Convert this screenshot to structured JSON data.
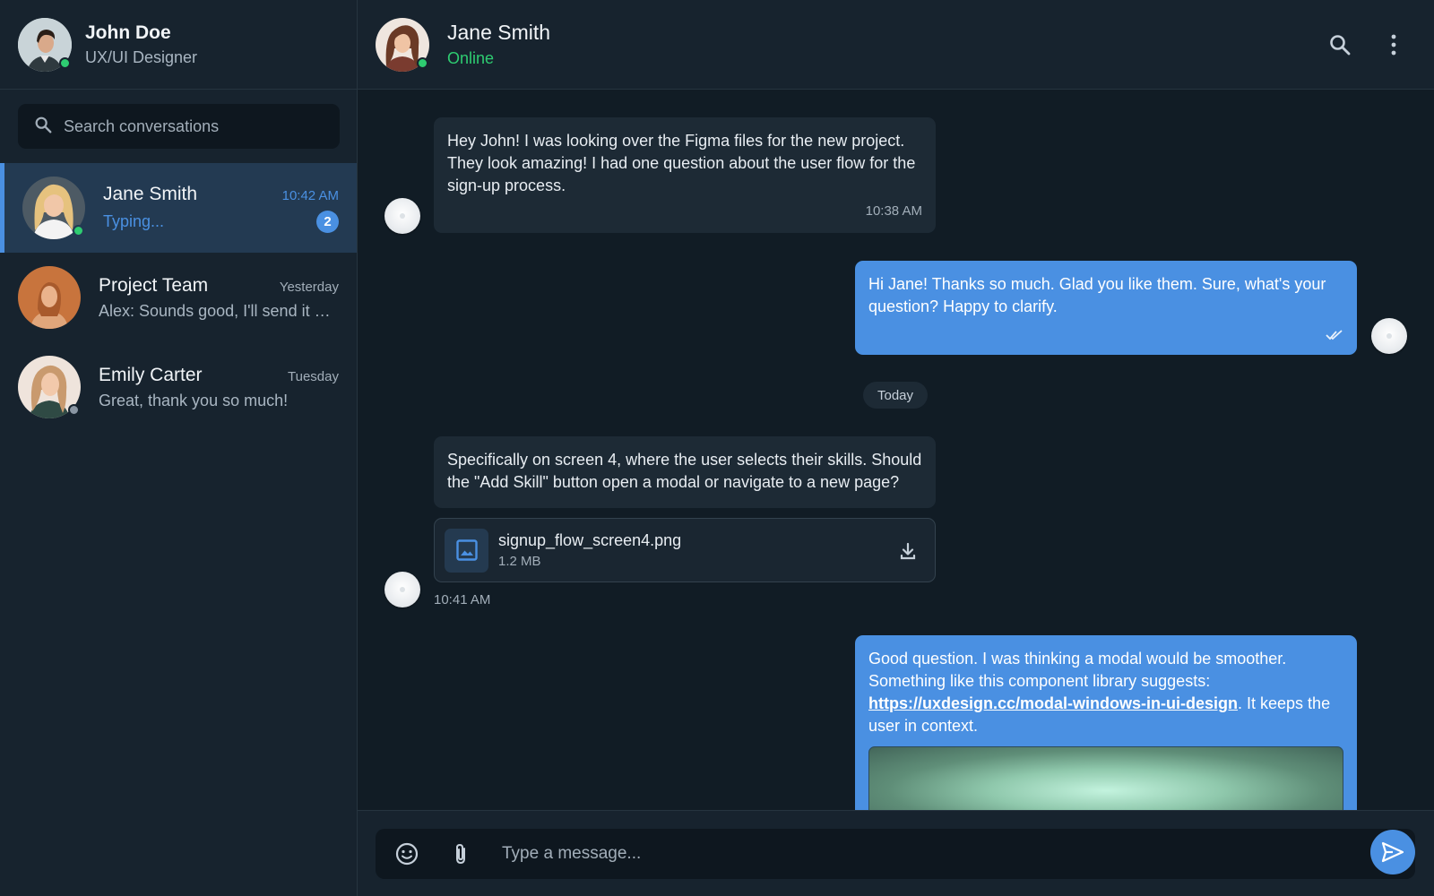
{
  "colors": {
    "accent": "#4a90e2",
    "online": "#2ecc71",
    "offline": "#8a96a3",
    "sidebar_bg": "#17232e",
    "chat_bg": "#111c25"
  },
  "profile": {
    "name": "John Doe",
    "role": "UX/UI Designer",
    "status": "online"
  },
  "search": {
    "placeholder": "Search conversations"
  },
  "conversations": [
    {
      "name": "Jane Smith",
      "time": "10:42 AM",
      "preview": "Typing...",
      "unread": "2",
      "status": "online",
      "active": true
    },
    {
      "name": "Project Team",
      "time": "Yesterday",
      "preview": "Alex: Sounds good, I'll send it over.",
      "active": false
    },
    {
      "name": "Emily Carter",
      "time": "Tuesday",
      "preview": "Great, thank you so much!",
      "status": "offline",
      "active": false
    }
  ],
  "chat": {
    "name": "Jane Smith",
    "status": "Online",
    "icons": {
      "search": "search-icon",
      "menu": "more-vertical-icon"
    }
  },
  "messages": {
    "m1": {
      "text": "Hey John! I was looking over the Figma files for the new project. They look amazing! I had one question about the user flow for the sign-up process.",
      "time": "10:38 AM"
    },
    "m2": {
      "text": "Hi Jane! Thanks so much. Glad you like them. Sure, what's your question? Happy to clarify.",
      "read": "double-check-icon"
    },
    "date_divider": "Today",
    "m3": {
      "text": "Specifically on screen 4, where the user selects their skills. Should the \"Add Skill\" button open a modal or navigate to a new page?"
    },
    "attachment": {
      "file_name": "signup_flow_screen4.png",
      "file_size": "1.2 MB",
      "time": "10:41 AM"
    },
    "m4": {
      "text_before": "Good question. I was thinking a modal would be smoother. Something like this component library suggests: ",
      "link": "https://uxdesign.cc/modal-windows-in-ui-design",
      "text_after": ". It keeps the user in context."
    }
  },
  "composer": {
    "placeholder": "Type a message..."
  }
}
